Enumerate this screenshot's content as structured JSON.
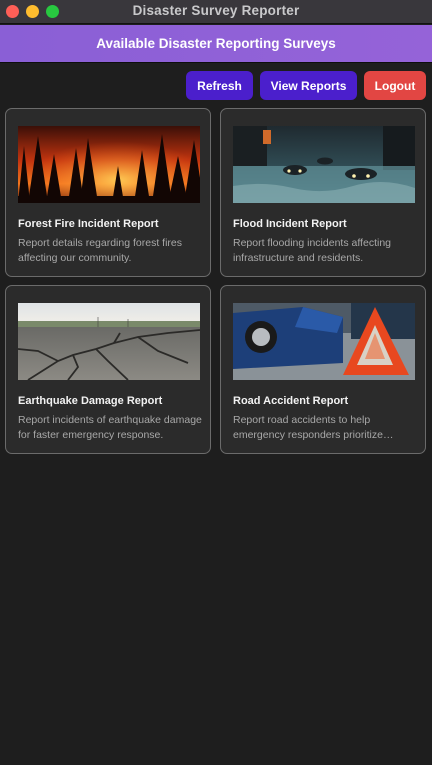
{
  "window": {
    "title": "Disaster Survey Reporter"
  },
  "header": {
    "title": "Available Disaster Reporting Surveys"
  },
  "toolbar": {
    "refresh_label": "Refresh",
    "view_reports_label": "View Reports",
    "logout_label": "Logout"
  },
  "colors": {
    "header": "#9563d8",
    "primary_button": "#4b1fcc",
    "logout_button": "#e24643",
    "background": "#1e1e1e",
    "card": "#2b2b2b"
  },
  "surveys": [
    {
      "title": "Forest Fire Incident Report",
      "description": "Report details regarding forest fires affecting our community.",
      "image": "forest-fire-photo"
    },
    {
      "title": "Flood Incident Report",
      "description": "Report flooding incidents affecting infrastructure and residents.",
      "image": "flooded-street-photo"
    },
    {
      "title": "Earthquake Damage Report",
      "description": "Report incidents of earthquake damage for faster emergency response.",
      "image": "cracked-road-photo"
    },
    {
      "title": "Road Accident Report",
      "description": "Report road accidents to help emergency responders prioritize response.",
      "image": "car-crash-warning-triangle-photo"
    }
  ]
}
